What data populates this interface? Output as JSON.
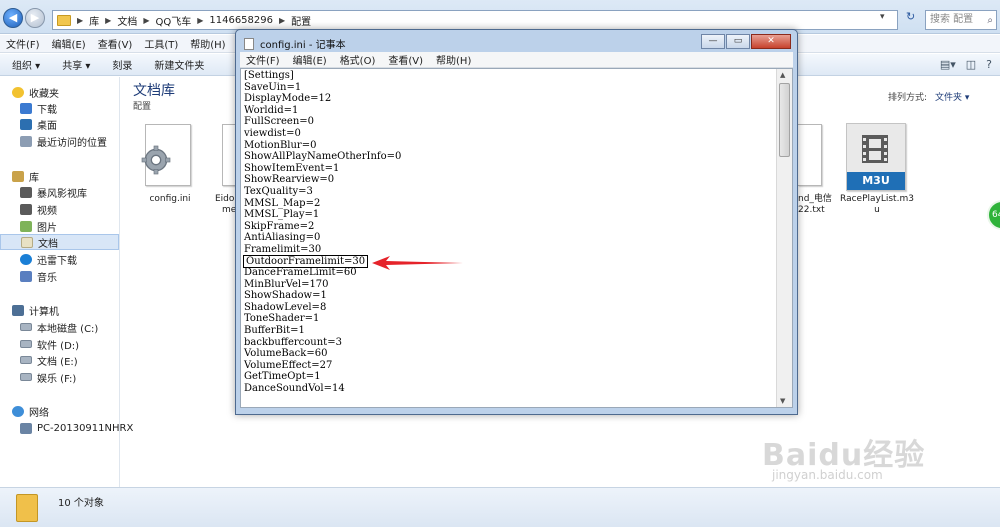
{
  "address": {
    "crumbs": [
      "库",
      "文档",
      "QQ飞车",
      "1146658296",
      "配置"
    ],
    "search_placeholder": "搜索 配置"
  },
  "menu": {
    "items": [
      "文件(F)",
      "编辑(E)",
      "查看(V)",
      "工具(T)",
      "帮助(H)"
    ]
  },
  "toolbar": {
    "items": [
      "组织 ▾",
      "共享 ▾",
      "刻录",
      "新建文件夹"
    ]
  },
  "nav": {
    "favorites": "收藏夹",
    "downloads": "下载",
    "desktop": "桌面",
    "recent": "最近访问的位置",
    "libraries": "库",
    "baofeng": "暴风影视库",
    "videos": "视频",
    "pictures": "图片",
    "documents": "文档",
    "thunder": "迅雷下载",
    "music": "音乐",
    "computer": "计算机",
    "disk_c": "本地磁盘 (C:)",
    "disk_d": "软件 (D:)",
    "disk_e": "文档 (E:)",
    "disk_f": "娱乐 (F:)",
    "network": "网络",
    "pc_name": "PC-20130911NHRX"
  },
  "content": {
    "library_title": "文档库",
    "library_sub": "配置",
    "arrange_label": "排列方式:",
    "arrange_value": "文件夹 ▾",
    "files": {
      "config": "config.ini",
      "eido_1": "Eido",
      "eido_2": "me",
      "txt_1": "nd_电信",
      "txt_2": "22.txt",
      "m3u_badge": "M3U",
      "m3u_1": "RacePlayList.m3",
      "m3u_2": "u"
    }
  },
  "status": {
    "count": "10 个对象"
  },
  "badge": {
    "text": "64"
  },
  "watermark": {
    "brand": "Baidu经验",
    "url": "jingyan.baidu.com"
  },
  "notepad": {
    "title": "config.ini - 记事本",
    "menu": [
      "文件(F)",
      "编辑(E)",
      "格式(O)",
      "查看(V)",
      "帮助(H)"
    ],
    "lines": [
      "[Settings]",
      "SaveUin=1",
      "DisplayMode=12",
      "Worldid=1",
      "FullScreen=0",
      "viewdist=0",
      "MotionBlur=0",
      "ShowAllPlayNameOtherInfo=0",
      "ShowItemEvent=1",
      "ShowRearview=0",
      "TexQuality=3",
      "MMSL_Map=2",
      "MMSL_Play=1",
      "SkipFrame=2",
      "AntiAliasing=0",
      "Framelimit=30",
      "OutdoorFramelimit=30",
      "DanceFrameLimit=60",
      "MinBlurVel=170",
      "ShowShadow=1",
      "ShadowLevel=8",
      "ToneShader=1",
      "BufferBit=1",
      "backbuffercount=3",
      "VolumeBack=60",
      "VolumeEffect=27",
      "GetTimeOpt=1",
      "DanceSoundVol=14"
    ],
    "highlight_line": "OutdoorFramelimit=30"
  }
}
